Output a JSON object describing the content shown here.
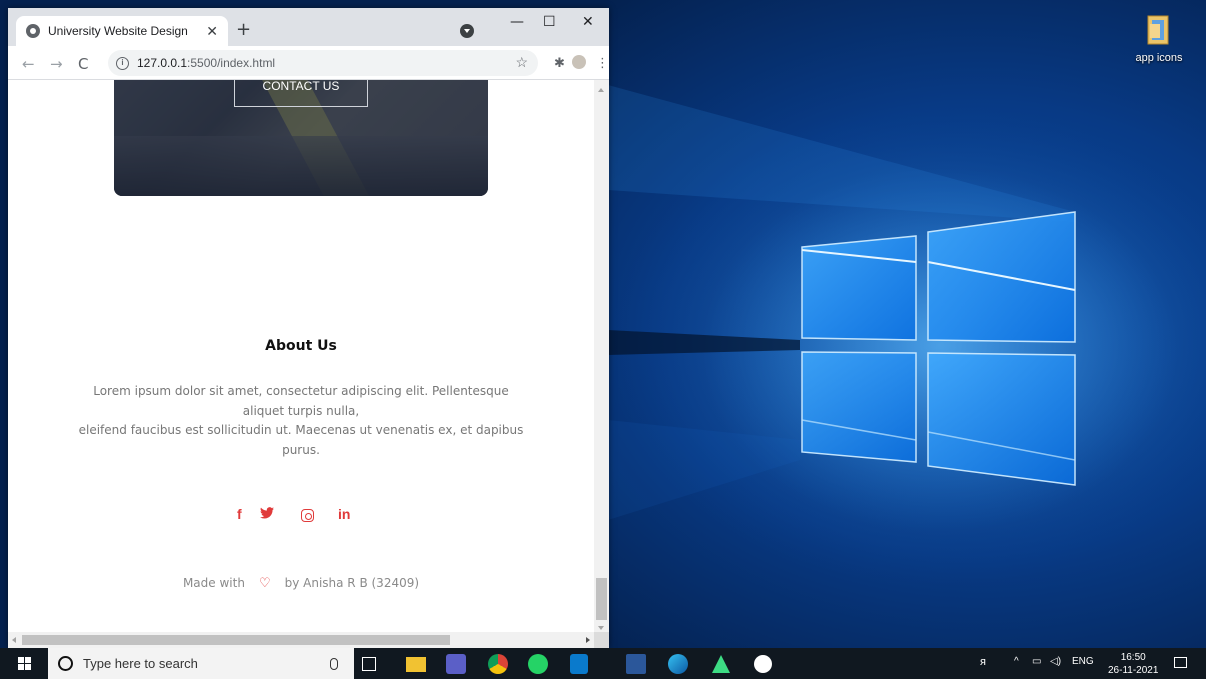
{
  "browser": {
    "tab_title": "University Website Design",
    "url_host": "127.0.0.1",
    "url_path": ":5500/index.html",
    "icons": {
      "tab": "globe-icon",
      "close_tab": "close-icon",
      "new_tab": "plus-icon",
      "back": "back-arrow-icon",
      "forward": "forward-arrow-icon",
      "reload": "reload-icon",
      "site_info": "info-icon",
      "bookmark": "star-icon",
      "extensions": "puzzle-icon",
      "menu": "kebab-menu-icon"
    },
    "window_controls": [
      "minimize",
      "maximize",
      "close"
    ]
  },
  "page": {
    "contact_button": "CONTACT US",
    "about_title": "About Us",
    "about_lines": [
      "Lorem ipsum dolor sit amet, consectetur adipiscing elit. Pellentesque",
      "aliquet turpis nulla,",
      "eleifend faucibus est sollicitudin ut. Maecenas ut venenatis ex, et dapibus",
      "purus."
    ],
    "social_icons": [
      "facebook-icon",
      "twitter-icon",
      "instagram-icon",
      "linkedin-icon"
    ],
    "social_glyphs": {
      "facebook": "f",
      "linkedin": "in"
    },
    "footer_prefix": "Made with",
    "footer_suffix": "by Anisha R B (32409)",
    "accent_color": "#e03a3a"
  },
  "desktop": {
    "icon_label": "app icons"
  },
  "taskbar": {
    "search_placeholder": "Type here to search",
    "pinned": [
      "task-view",
      "file-explorer",
      "teams",
      "chrome",
      "whatsapp",
      "vscode",
      "word",
      "edge",
      "app",
      "app"
    ],
    "language": "ENG",
    "time": "16:50",
    "date": "26-11-2021"
  }
}
